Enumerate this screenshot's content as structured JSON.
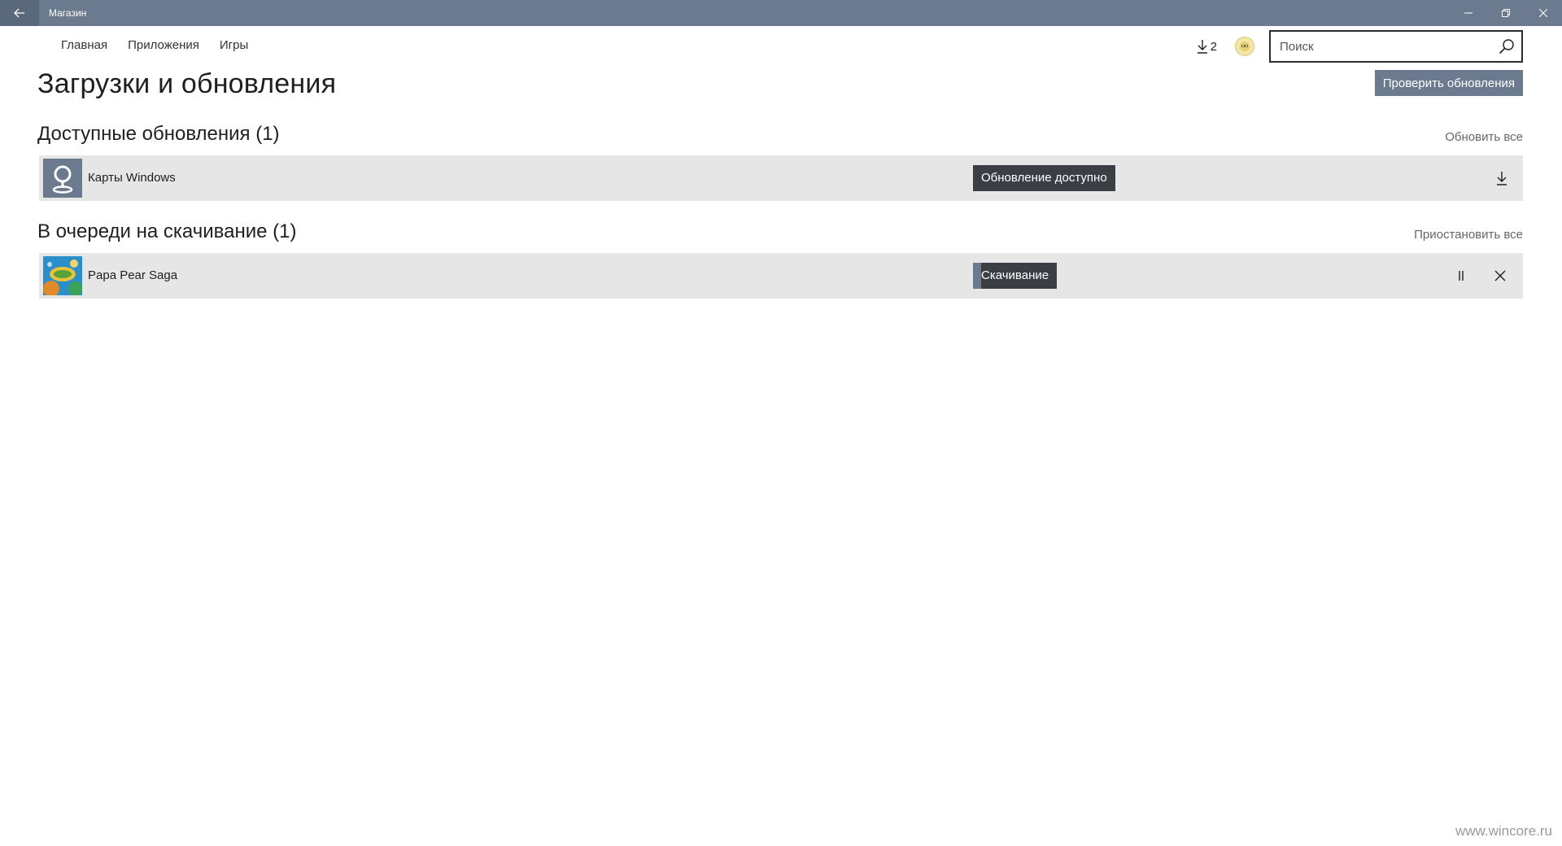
{
  "window": {
    "title": "Магазин",
    "back_icon": "back-arrow-icon",
    "controls": [
      "minimize-icon",
      "restore-icon",
      "close-icon"
    ]
  },
  "nav": {
    "items": [
      {
        "label": "Главная"
      },
      {
        "label": "Приложения"
      },
      {
        "label": "Игры"
      }
    ]
  },
  "header": {
    "downloads_count": "2",
    "search": {
      "placeholder": "Поиск",
      "value": ""
    }
  },
  "page": {
    "title": "Загрузки и обновления",
    "check_updates_label": "Проверить обновления"
  },
  "updates": {
    "heading": "Доступные обновления (1)",
    "action_label": "Обновить все",
    "items": [
      {
        "name": "Карты Windows",
        "status": "Обновление доступно",
        "icon": "maps-app-icon"
      }
    ]
  },
  "queue": {
    "heading": "В очереди на скачивание (1)",
    "action_label": "Приостановить все",
    "items": [
      {
        "name": "Papa Pear Saga",
        "status": "Скачивание",
        "progress": 0.1,
        "icon": "papa-pear-saga-icon"
      }
    ]
  },
  "watermark": "www.wincore.ru",
  "colors": {
    "accent": "#6b7a8f",
    "badge": "#3b3f45",
    "row_bg": "#e6e6e6"
  }
}
